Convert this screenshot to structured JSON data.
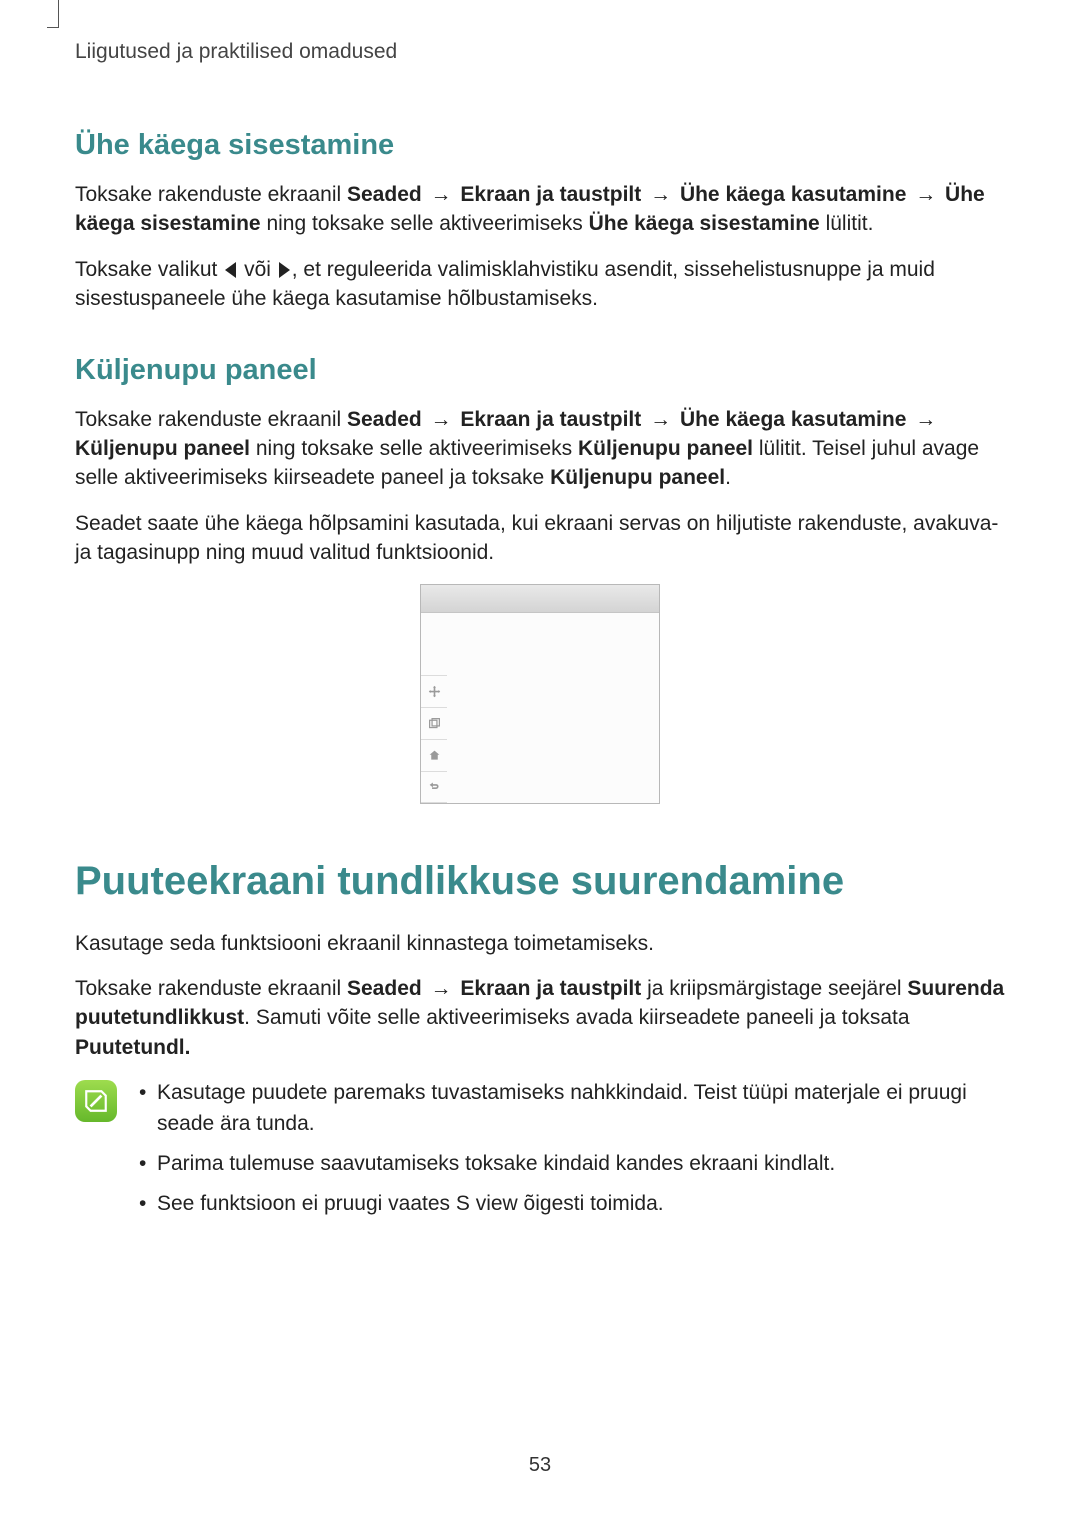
{
  "header": {
    "running_head": "Liigutused ja praktilised omadused"
  },
  "section1": {
    "title": "Ühe käega sisestamine",
    "p1_pre": "Toksake rakenduste ekraanil ",
    "p1_b1": "Seaded",
    "arrow": " → ",
    "p1_b2": "Ekraan ja taustpilt",
    "p1_b3": "Ühe käega kasutamine",
    "p1_b4": "Ühe käega sisestamine",
    "p1_mid": " ning toksake selle aktiveerimiseks ",
    "p1_b5": "Ühe käega sisestamine",
    "p1_end": " lülitit.",
    "p2_pre": "Toksake valikut ",
    "p2_mid": " või ",
    "p2_end": ", et reguleerida valimisklahvistiku asendit, sissehelistusnuppe ja muid sisestuspaneele ühe käega kasutamise hõlbustamiseks."
  },
  "section2": {
    "title": "Küljenupu paneel",
    "p1_pre": "Toksake rakenduste ekraanil ",
    "p1_b1": "Seaded",
    "p1_b2": "Ekraan ja taustpilt",
    "p1_b3": "Ühe käega kasutamine",
    "p1_b4": "Küljenupu paneel",
    "p1_mid": " ning toksake selle aktiveerimiseks ",
    "p1_b5": "Küljenupu paneel",
    "p1_mid2": " lülitit. Teisel juhul avage selle aktiveerimiseks kiirseadete paneel ja toksake ",
    "p1_b6": "Küljenupu paneel",
    "p1_end": ".",
    "p2": "Seadet saate ühe käega hõlpsamini kasutada, kui ekraani servas on hiljutiste rakenduste, avakuva- ja tagasinupp ning muud valitud funktsioonid."
  },
  "figure": {
    "icons": [
      "move",
      "recent",
      "home",
      "back"
    ]
  },
  "section3": {
    "title": "Puuteekraani tundlikkuse suurendamine",
    "p1": "Kasutage seda funktsiooni ekraanil kinnastega toimetamiseks.",
    "p2_pre": "Toksake rakenduste ekraanil ",
    "p2_b1": "Seaded",
    "p2_b2": "Ekraan ja taustpilt",
    "p2_mid": " ja kriipsmärgistage seejärel ",
    "p2_b3": "Suurenda puutetundlikkust",
    "p2_mid2": ". Samuti võite selle aktiveerimiseks avada kiirseadete paneeli ja toksata ",
    "p2_b4": "Puutetundl.",
    "notes": [
      "Kasutage puudete paremaks tuvastamiseks nahkkindaid. Teist tüüpi materjale ei pruugi seade ära tunda.",
      "Parima tulemuse saavutamiseks toksake kindaid kandes ekraani kindlalt.",
      "See funktsioon ei pruugi vaates S view õigesti toimida."
    ]
  },
  "page_number": "53"
}
